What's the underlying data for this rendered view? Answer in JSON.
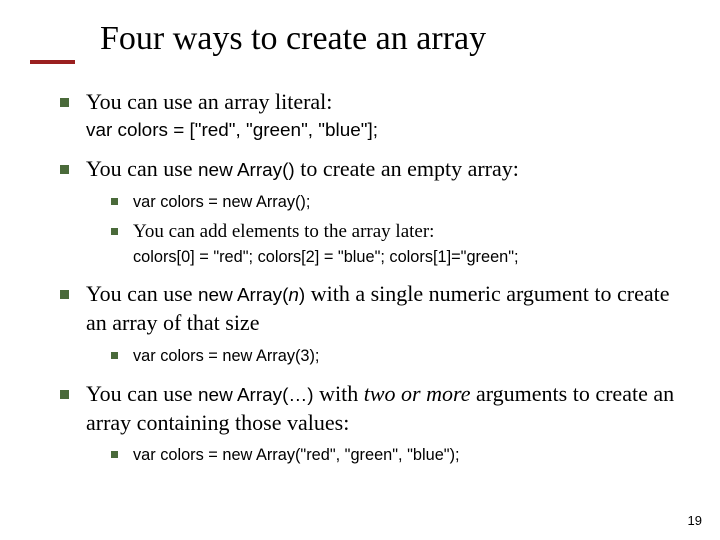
{
  "title": "Four ways to create an array",
  "bullets": {
    "b1": {
      "text": "You can use an array literal:",
      "sub": "var colors = [\"red\", \"green\", \"blue\"];"
    },
    "b2": {
      "text_a": "You can use ",
      "code": "new Array()",
      "text_b": " to create an empty array:",
      "subs": {
        "s1": "var colors = new Array();",
        "s2": {
          "text": "You can add elements to the array later:",
          "code": "colors[0] = \"red\"; colors[2] = \"blue\"; colors[1]=\"green\";"
        }
      }
    },
    "b3": {
      "text_a": "You can use ",
      "code_a": "new Array(",
      "param": "n",
      "code_b": ")",
      "text_b": " with a single numeric argument to create an array of that size",
      "subs": {
        "s1": "var colors = new Array(3);"
      }
    },
    "b4": {
      "text_a": "You can use ",
      "code": "new Array(…)",
      "text_b": " with ",
      "italic": "two or more",
      "text_c": " arguments to create an array containing those values:",
      "subs": {
        "s1": "var colors = new Array(\"red\", \"green\", \"blue\");"
      }
    }
  },
  "page_number": "19"
}
